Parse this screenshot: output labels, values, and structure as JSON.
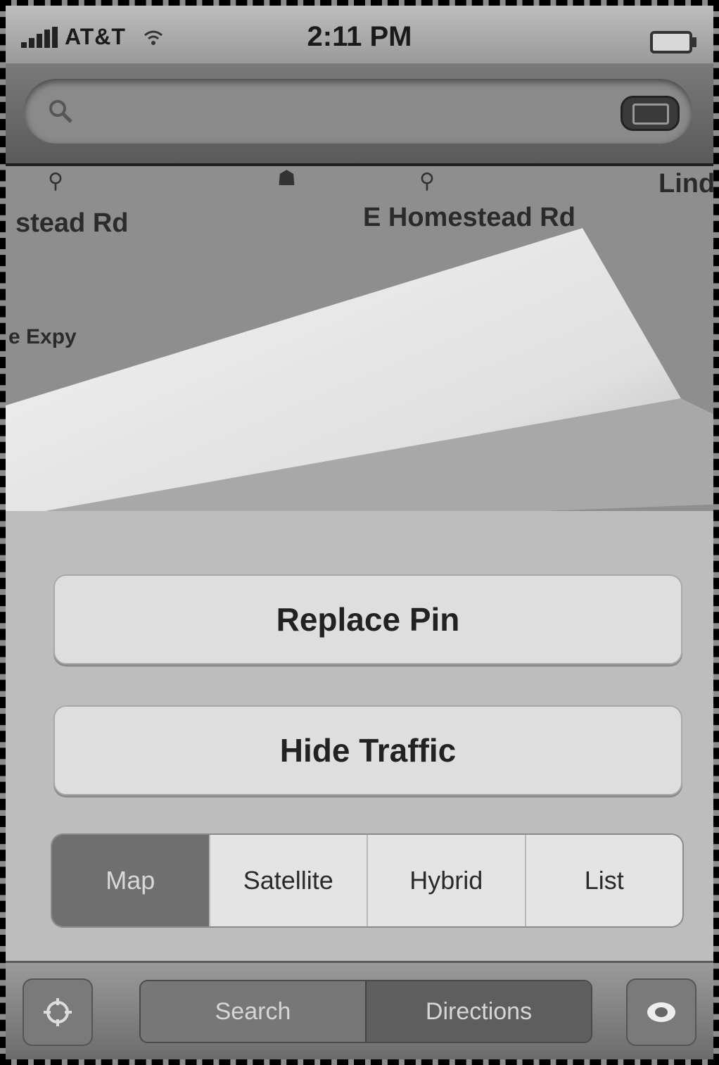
{
  "status_bar": {
    "carrier": "AT&T",
    "time": "2:11 PM"
  },
  "search": {
    "value": "",
    "placeholder": ""
  },
  "map": {
    "road_labels": [
      "stead Rd",
      "E Homestead Rd",
      "e Expy"
    ],
    "edge_label": "Lindt"
  },
  "options": {
    "replace_pin": "Replace Pin",
    "hide_traffic": "Hide Traffic",
    "map_types": [
      "Map",
      "Satellite",
      "Hybrid",
      "List"
    ],
    "selected_map_type": "Map"
  },
  "bottom_bar": {
    "search": "Search",
    "directions": "Directions"
  },
  "colors": {
    "selected_segment": "#6f6f6f",
    "button_face": "#dedede"
  }
}
